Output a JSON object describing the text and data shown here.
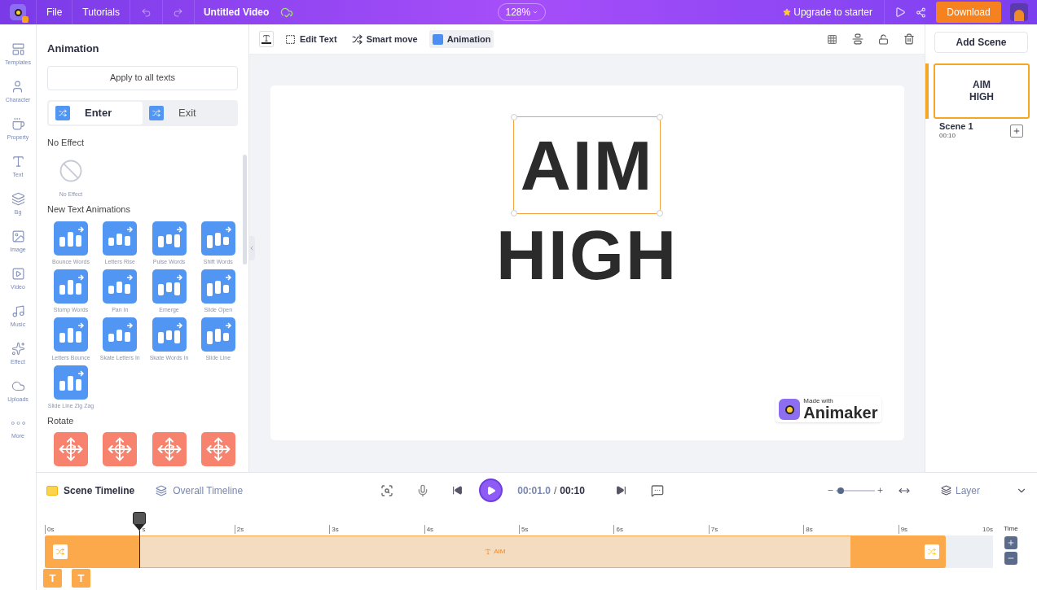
{
  "topbar": {
    "menu": [
      "File",
      "Tutorials"
    ],
    "title": "Untitled Video",
    "zoom": "128%",
    "upgrade": "Upgrade to starter",
    "download": "Download"
  },
  "rail": [
    "Templates",
    "Character",
    "Property",
    "Text",
    "Bg",
    "Image",
    "Video",
    "Music",
    "Effect",
    "Uploads",
    "More"
  ],
  "toolbar": [
    {
      "label": "Edit Text",
      "selected": false
    },
    {
      "label": "Smart move",
      "selected": false
    },
    {
      "label": "Animation",
      "selected": true
    }
  ],
  "panel": {
    "title": "Animation",
    "apply": "Apply to all texts",
    "tabs": [
      {
        "label": "Enter",
        "selected": true
      },
      {
        "label": "Exit",
        "selected": false
      }
    ],
    "sections": [
      {
        "title": "No Effect",
        "items": [
          {
            "kind": "none",
            "label": "No Effect"
          }
        ]
      },
      {
        "title": "New Text Animations",
        "items": [
          {
            "kind": "text",
            "label": "Bounce Words"
          },
          {
            "kind": "text",
            "label": "Letters Rise"
          },
          {
            "kind": "text",
            "label": "Pulse Words"
          },
          {
            "kind": "text",
            "label": "Shift Words"
          },
          {
            "kind": "text",
            "label": "Stomp Words"
          },
          {
            "kind": "text",
            "label": "Pan In"
          },
          {
            "kind": "text",
            "label": "Emerge"
          },
          {
            "kind": "text",
            "label": "Slide Open"
          },
          {
            "kind": "text",
            "label": "Letters Bounce"
          },
          {
            "kind": "text",
            "label": "Skate Letters In"
          },
          {
            "kind": "text",
            "label": "Skate Words In"
          },
          {
            "kind": "text",
            "label": "Slide Line"
          },
          {
            "kind": "text",
            "label": "Slide Line Zig Zag"
          }
        ]
      },
      {
        "title": "Rotate",
        "items": [
          {
            "kind": "rotate"
          },
          {
            "kind": "rotate"
          },
          {
            "kind": "rotate"
          },
          {
            "kind": "rotate"
          }
        ]
      }
    ]
  },
  "canvas": {
    "lines": [
      {
        "text": "AIM",
        "selected": true
      },
      {
        "text": "HIGH",
        "selected": false
      }
    ],
    "watermark_caption": "Made with",
    "watermark_brand": "Animaker"
  },
  "scenes": {
    "add": "Add Scene",
    "items": [
      {
        "preview": [
          "AIM",
          "HIGH"
        ],
        "name": "Scene 1",
        "duration": "00:10",
        "selected": true
      }
    ]
  },
  "timeline": {
    "tabs": [
      {
        "label": "Scene Timeline",
        "selected": true
      },
      {
        "label": "Overall Timeline",
        "selected": false
      }
    ],
    "current": "00:01.0",
    "separator": "/",
    "total": "00:10",
    "zoom": {
      "level": 0.12
    },
    "layer": "Layer",
    "ticks": [
      "0s",
      "s",
      "2s",
      "3s",
      "4s",
      "5s",
      "6s",
      "7s",
      "8s",
      "9s"
    ],
    "end_tick": "10s",
    "time_label": "Time",
    "playhead": {
      "level": 0.1
    },
    "clip_label": "AIM",
    "rows": [
      "T",
      "T"
    ]
  }
}
